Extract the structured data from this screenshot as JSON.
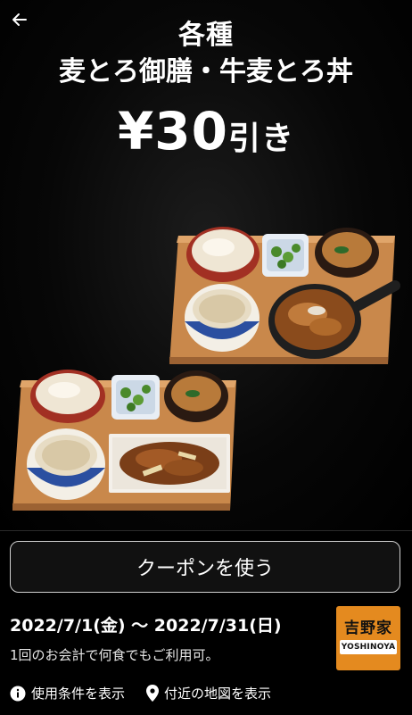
{
  "header": {
    "back_icon": "arrow-left-icon"
  },
  "promo": {
    "line1": "各種",
    "line2": "麦とろ御膳・牛麦とろ丼",
    "discount_amount": "¥30",
    "discount_suffix": "引き"
  },
  "coupon": {
    "use_button": "クーポンを使う",
    "period": "2022/7/1(金) 〜 2022/7/31(日)",
    "note": "1回のお会計で何食でもご利用可。"
  },
  "brand": {
    "logo_jp": "吉野家",
    "logo_en": "YOSHINOYA"
  },
  "footer": {
    "terms_link": "使用条件を表示",
    "map_link": "付近の地図を表示",
    "terms_icon": "info-icon",
    "map_icon": "map-pin-icon"
  },
  "colors": {
    "background": "#000000",
    "brand_orange": "#e48a1f",
    "tray": "#c9884b"
  }
}
